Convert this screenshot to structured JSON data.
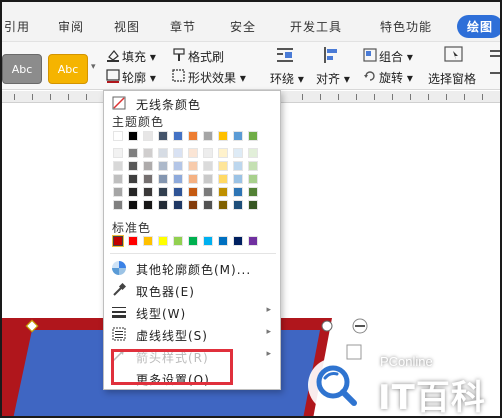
{
  "tabs": [
    "引用",
    "审阅",
    "视图",
    "章节",
    "安全",
    "开发工具",
    "特色功能",
    "绘图"
  ],
  "ribbon": {
    "style_preset_1": "Abc",
    "style_preset_2": "Abc",
    "fill": "填充",
    "format_painter": "格式刷",
    "outline": "轮廓",
    "shape_effects": "形状效果",
    "wrap": "环绕",
    "align": "对齐",
    "group": "组合",
    "rotate": "旋转",
    "selection_pane": "选择窗格"
  },
  "menu": {
    "no_line_color": "无线条颜色",
    "theme_colors": "主题颜色",
    "standard_colors": "标准色",
    "more_outline_colors": "其他轮廓颜色(M)...",
    "eyedropper": "取色器(E)",
    "line_type": "线型(W)",
    "dash_type": "虚线线型(S)",
    "arrow_style": "箭头样式(R)",
    "more_settings": "更多设置(O)..."
  },
  "theme_top_row": [
    "#ffffff",
    "#000000",
    "#e7e6e6",
    "#44546a",
    "#4472c4",
    "#ed7d31",
    "#a5a5a5",
    "#ffc000",
    "#5b9bd5",
    "#70ad47"
  ],
  "theme_shades": [
    [
      "#f2f2f2",
      "#7f7f7f",
      "#d0cece",
      "#d6dce4",
      "#d9e2f3",
      "#fbe5d5",
      "#ededed",
      "#fff2cc",
      "#deebf6",
      "#e2efd9"
    ],
    [
      "#d8d8d8",
      "#595959",
      "#aeabab",
      "#adb9ca",
      "#b4c6e7",
      "#f7cbac",
      "#dbdbdb",
      "#fee599",
      "#bdd7ee",
      "#c5e0b3"
    ],
    [
      "#bfbfbf",
      "#3f3f3f",
      "#757070",
      "#8496b0",
      "#8eaadb",
      "#f4b183",
      "#c9c9c9",
      "#ffd965",
      "#9cc3e5",
      "#a8d08d"
    ],
    [
      "#a5a5a5",
      "#262626",
      "#3a3838",
      "#323f4f",
      "#2f5496",
      "#c55a11",
      "#7b7b7b",
      "#bf9000",
      "#2e75b5",
      "#538135"
    ],
    [
      "#7f7f7f",
      "#0c0c0c",
      "#171616",
      "#222a35",
      "#1f3864",
      "#833c0b",
      "#525252",
      "#7f6000",
      "#1e4e79",
      "#375623"
    ]
  ],
  "standard_colors_list": [
    "#c00000",
    "#ff0000",
    "#ffc000",
    "#ffff00",
    "#92d050",
    "#00b050",
    "#00b0f0",
    "#0070c0",
    "#002060",
    "#7030a0"
  ],
  "logo": {
    "brand": "PConline",
    "wordmark": "IT百科"
  },
  "colors": {
    "accent": "#2e6fd8",
    "highlight_box": "#e0303c",
    "shape_fill": "#3f66c2",
    "shape_border": "#b0161c"
  }
}
